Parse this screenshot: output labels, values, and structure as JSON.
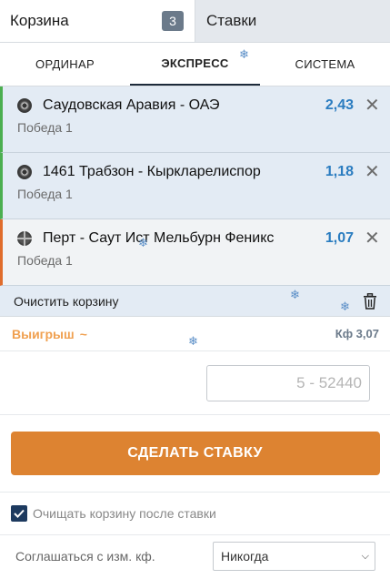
{
  "top_tabs": {
    "cart_label": "Корзина",
    "cart_count": "3",
    "bets_label": "Ставки"
  },
  "sub_tabs": [
    {
      "label": "ОРДИНАР"
    },
    {
      "label": "ЭКСПРЕСС"
    },
    {
      "label": "СИСТЕМА"
    }
  ],
  "bets": [
    {
      "match": "Саудовская Аравия - ОАЭ",
      "outcome": "Победа 1",
      "odds": "2,43",
      "sport_icon": "football-icon"
    },
    {
      "match": "1461 Трабзон - Кыркларелиспор",
      "outcome": "Победа 1",
      "odds": "1,18",
      "sport_icon": "football-icon"
    },
    {
      "match": "Перт - Саут Ист Мельбурн Феникс",
      "outcome": "Победа 1",
      "odds": "1,07",
      "sport_icon": "basketball-icon"
    }
  ],
  "clear_cart": {
    "label": "Очистить корзину",
    "icon": "trash-icon"
  },
  "winnings": {
    "label": "Выигрыш",
    "chevron": "~",
    "coefficient": "Кф 3,07",
    "accent": "#f0a050"
  },
  "stake": {
    "placeholder": "5 - 52440"
  },
  "place_bet": {
    "label": "СДЕЛАТЬ СТАВКУ",
    "color": "#dd8331"
  },
  "clear_after": {
    "label": "Очищать корзину после ставки",
    "checked": true
  },
  "accept_changes": {
    "label": "Соглашаться с изм. кф.",
    "value": "Никогда"
  },
  "decoration": {
    "snowflake": "❄"
  }
}
